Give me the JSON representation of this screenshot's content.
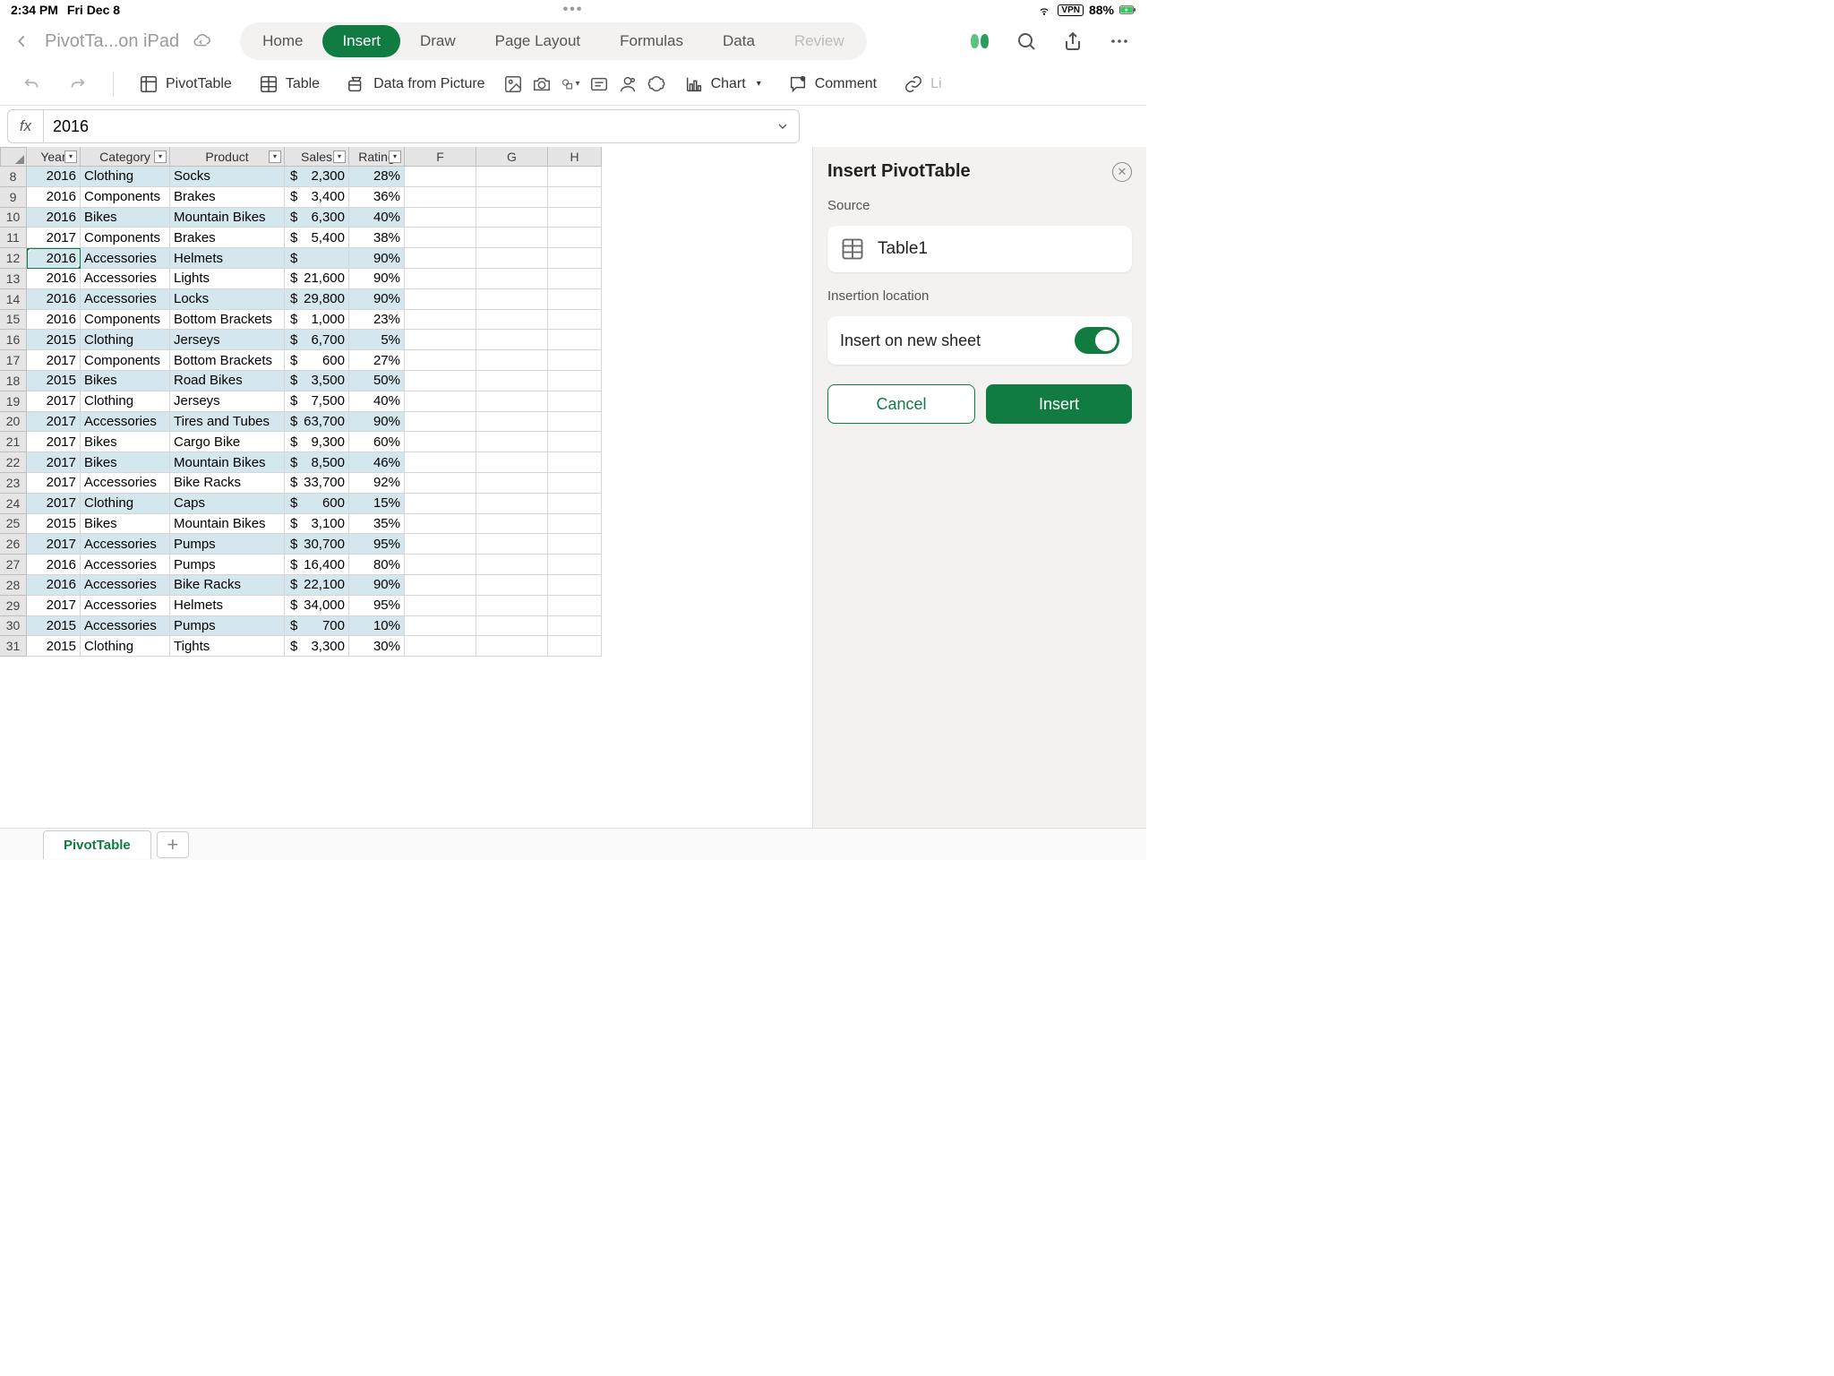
{
  "status": {
    "time": "2:34 PM",
    "date": "Fri Dec 8",
    "vpn": "VPN",
    "battery": "88%"
  },
  "doc": {
    "title": "PivotTa...on iPad"
  },
  "ribbon": {
    "home": "Home",
    "insert": "Insert",
    "draw": "Draw",
    "pageLayout": "Page Layout",
    "formulas": "Formulas",
    "data": "Data",
    "review": "Review"
  },
  "toolbar": {
    "pivotTable": "PivotTable",
    "table": "Table",
    "dataFromPicture": "Data from Picture",
    "chart": "Chart",
    "comment": "Comment",
    "link": "Li"
  },
  "formula": {
    "fx": "fx",
    "value": "2016"
  },
  "columns": {
    "A": "Year",
    "B": "Category",
    "C": "Product",
    "D": "Sales",
    "E": "Rating",
    "F": "F",
    "G": "G",
    "H": "H"
  },
  "rows": [
    {
      "n": 8,
      "year": "2016",
      "cat": "Clothing",
      "prod": "Socks",
      "sales": "2,300",
      "rating": "28%",
      "band": true
    },
    {
      "n": 9,
      "year": "2016",
      "cat": "Components",
      "prod": "Brakes",
      "sales": "3,400",
      "rating": "36%",
      "band": false
    },
    {
      "n": 10,
      "year": "2016",
      "cat": "Bikes",
      "prod": "Mountain Bikes",
      "sales": "6,300",
      "rating": "40%",
      "band": true
    },
    {
      "n": 11,
      "year": "2017",
      "cat": "Components",
      "prod": "Brakes",
      "sales": "5,400",
      "rating": "38%",
      "band": false
    },
    {
      "n": 12,
      "year": "2016",
      "cat": "Accessories",
      "prod": "Helmets",
      "sales": "",
      "rating": "90%",
      "band": true,
      "selected": true
    },
    {
      "n": 13,
      "year": "2016",
      "cat": "Accessories",
      "prod": "Lights",
      "sales": "21,600",
      "rating": "90%",
      "band": false
    },
    {
      "n": 14,
      "year": "2016",
      "cat": "Accessories",
      "prod": "Locks",
      "sales": "29,800",
      "rating": "90%",
      "band": true
    },
    {
      "n": 15,
      "year": "2016",
      "cat": "Components",
      "prod": "Bottom Brackets",
      "sales": "1,000",
      "rating": "23%",
      "band": false
    },
    {
      "n": 16,
      "year": "2015",
      "cat": "Clothing",
      "prod": "Jerseys",
      "sales": "6,700",
      "rating": "5%",
      "band": true
    },
    {
      "n": 17,
      "year": "2017",
      "cat": "Components",
      "prod": "Bottom Brackets",
      "sales": "600",
      "rating": "27%",
      "band": false
    },
    {
      "n": 18,
      "year": "2015",
      "cat": "Bikes",
      "prod": "Road Bikes",
      "sales": "3,500",
      "rating": "50%",
      "band": true
    },
    {
      "n": 19,
      "year": "2017",
      "cat": "Clothing",
      "prod": "Jerseys",
      "sales": "7,500",
      "rating": "40%",
      "band": false
    },
    {
      "n": 20,
      "year": "2017",
      "cat": "Accessories",
      "prod": "Tires and Tubes",
      "sales": "63,700",
      "rating": "90%",
      "band": true
    },
    {
      "n": 21,
      "year": "2017",
      "cat": "Bikes",
      "prod": "Cargo Bike",
      "sales": "9,300",
      "rating": "60%",
      "band": false
    },
    {
      "n": 22,
      "year": "2017",
      "cat": "Bikes",
      "prod": "Mountain Bikes",
      "sales": "8,500",
      "rating": "46%",
      "band": true
    },
    {
      "n": 23,
      "year": "2017",
      "cat": "Accessories",
      "prod": "Bike Racks",
      "sales": "33,700",
      "rating": "92%",
      "band": false
    },
    {
      "n": 24,
      "year": "2017",
      "cat": "Clothing",
      "prod": "Caps",
      "sales": "600",
      "rating": "15%",
      "band": true
    },
    {
      "n": 25,
      "year": "2015",
      "cat": "Bikes",
      "prod": "Mountain Bikes",
      "sales": "3,100",
      "rating": "35%",
      "band": false
    },
    {
      "n": 26,
      "year": "2017",
      "cat": "Accessories",
      "prod": "Pumps",
      "sales": "30,700",
      "rating": "95%",
      "band": true
    },
    {
      "n": 27,
      "year": "2016",
      "cat": "Accessories",
      "prod": "Pumps",
      "sales": "16,400",
      "rating": "80%",
      "band": false
    },
    {
      "n": 28,
      "year": "2016",
      "cat": "Accessories",
      "prod": "Bike Racks",
      "sales": "22,100",
      "rating": "90%",
      "band": true
    },
    {
      "n": 29,
      "year": "2017",
      "cat": "Accessories",
      "prod": "Helmets",
      "sales": "34,000",
      "rating": "95%",
      "band": false
    },
    {
      "n": 30,
      "year": "2015",
      "cat": "Accessories",
      "prod": "Pumps",
      "sales": "700",
      "rating": "10%",
      "band": true
    },
    {
      "n": 31,
      "year": "2015",
      "cat": "Clothing",
      "prod": "Tights",
      "sales": "3,300",
      "rating": "30%",
      "band": false
    }
  ],
  "panel": {
    "title": "Insert PivotTable",
    "sourceLabel": "Source",
    "sourceName": "Table1",
    "locationLabel": "Insertion location",
    "insertNewSheet": "Insert on new sheet",
    "cancel": "Cancel",
    "insert": "Insert"
  },
  "sheet": {
    "name": "PivotTable"
  },
  "currencySymbol": "$"
}
